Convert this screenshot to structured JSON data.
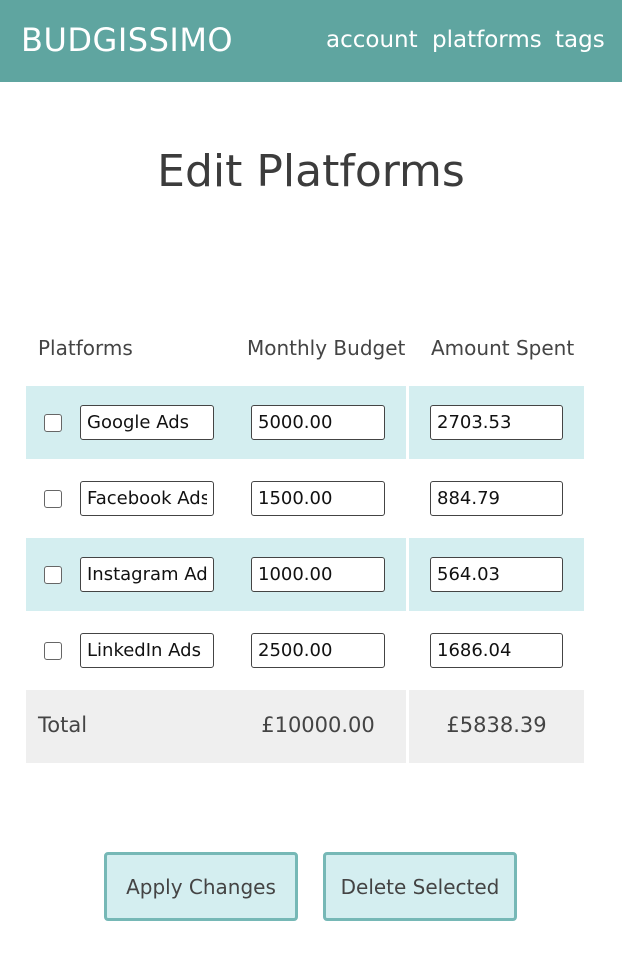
{
  "header": {
    "brand": "BUDGISSIMO",
    "nav": [
      {
        "label": "account"
      },
      {
        "label": "platforms"
      },
      {
        "label": "tags"
      }
    ]
  },
  "page": {
    "title": "Edit Platforms"
  },
  "table": {
    "columns": [
      "Platforms",
      "Monthly Budget",
      "Amount Spent"
    ],
    "rows": [
      {
        "selected": false,
        "name": "Google Ads",
        "budget": "5000.00",
        "spent": "2703.53"
      },
      {
        "selected": false,
        "name": "Facebook Ads",
        "budget": "1500.00",
        "spent": "884.79"
      },
      {
        "selected": false,
        "name": "Instagram Ads",
        "budget": "1000.00",
        "spent": "564.03"
      },
      {
        "selected": false,
        "name": "LinkedIn Ads",
        "budget": "2500.00",
        "spent": "1686.04"
      }
    ],
    "total": {
      "label": "Total",
      "budget": "£10000.00",
      "spent": "£5838.39"
    }
  },
  "actions": {
    "apply_label": "Apply Changes",
    "delete_label": "Delete Selected"
  },
  "colors": {
    "header_bg": "#5fa5a0",
    "row_shade": "#d4eef0",
    "total_bg": "#efefef",
    "button_border": "#76b8b6"
  }
}
